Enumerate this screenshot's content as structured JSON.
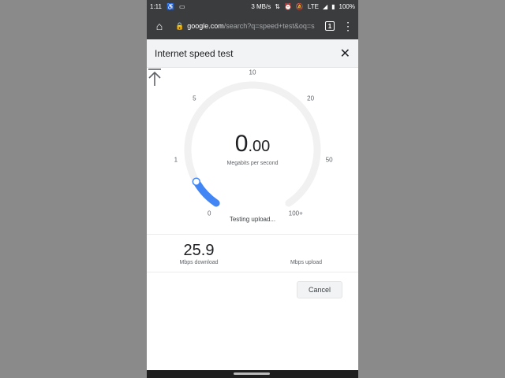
{
  "statusbar": {
    "time": "1:11",
    "speed": "3 MB/s",
    "network": "LTE",
    "battery": "100%"
  },
  "browser": {
    "url_host": "google.com",
    "url_path": "/search?q=speed+test&oq=s",
    "tab_count": "1"
  },
  "dialog": {
    "title": "Internet speed test",
    "close_label": "✕"
  },
  "gauge": {
    "ticks": [
      "0",
      "1",
      "5",
      "10",
      "20",
      "50",
      "100+"
    ],
    "reading_int": "0",
    "reading_dec": ".00",
    "unit": "Megabits per second",
    "status": "Testing upload...",
    "progress_fraction": 0.09,
    "accent": "#4285f4",
    "track": "#f1f1f1"
  },
  "results": {
    "download_value": "25.9",
    "download_label": "Mbps download",
    "upload_value": "",
    "upload_label": "Mbps upload"
  },
  "actions": {
    "cancel_label": "Cancel"
  }
}
